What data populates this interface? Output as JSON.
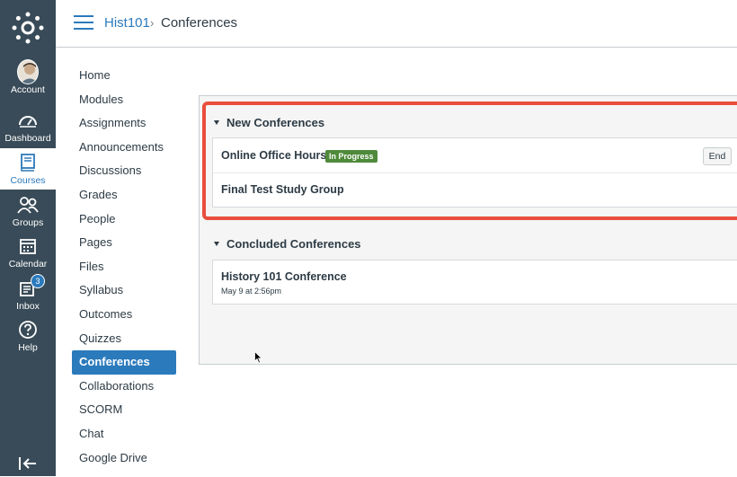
{
  "global_nav": {
    "items": [
      {
        "label": "Account",
        "icon": "avatar"
      },
      {
        "label": "Dashboard",
        "icon": "dashboard-icon"
      },
      {
        "label": "Courses",
        "icon": "courses-icon"
      },
      {
        "label": "Groups",
        "icon": "groups-icon"
      },
      {
        "label": "Calendar",
        "icon": "calendar-icon"
      },
      {
        "label": "Inbox",
        "icon": "inbox-icon",
        "badge": "3"
      },
      {
        "label": "Help",
        "icon": "help-icon"
      }
    ],
    "active": "Courses"
  },
  "header": {
    "course": "Hist101",
    "separator": "›",
    "current": "Conferences"
  },
  "course_nav": {
    "items": [
      "Home",
      "Modules",
      "Assignments",
      "Announcements",
      "Discussions",
      "Grades",
      "People",
      "Pages",
      "Files",
      "Syllabus",
      "Outcomes",
      "Quizzes",
      "Conferences",
      "Collaborations",
      "SCORM",
      "Chat",
      "Google Drive"
    ],
    "active": "Conferences"
  },
  "new_conferences": {
    "heading": "New Conferences",
    "items": [
      {
        "title": "Online Office Hours",
        "status": "In Progress",
        "action": "End"
      },
      {
        "title": "Final Test Study Group"
      }
    ]
  },
  "concluded_conferences": {
    "heading": "Concluded Conferences",
    "items": [
      {
        "title": "History 101 Conference",
        "date": "May 9 at 2:56pm"
      }
    ]
  },
  "colors": {
    "nav_bg": "#394b58",
    "accent": "#2b7abc",
    "highlight": "#e84e3c",
    "badge_green": "#4e8a3a"
  }
}
